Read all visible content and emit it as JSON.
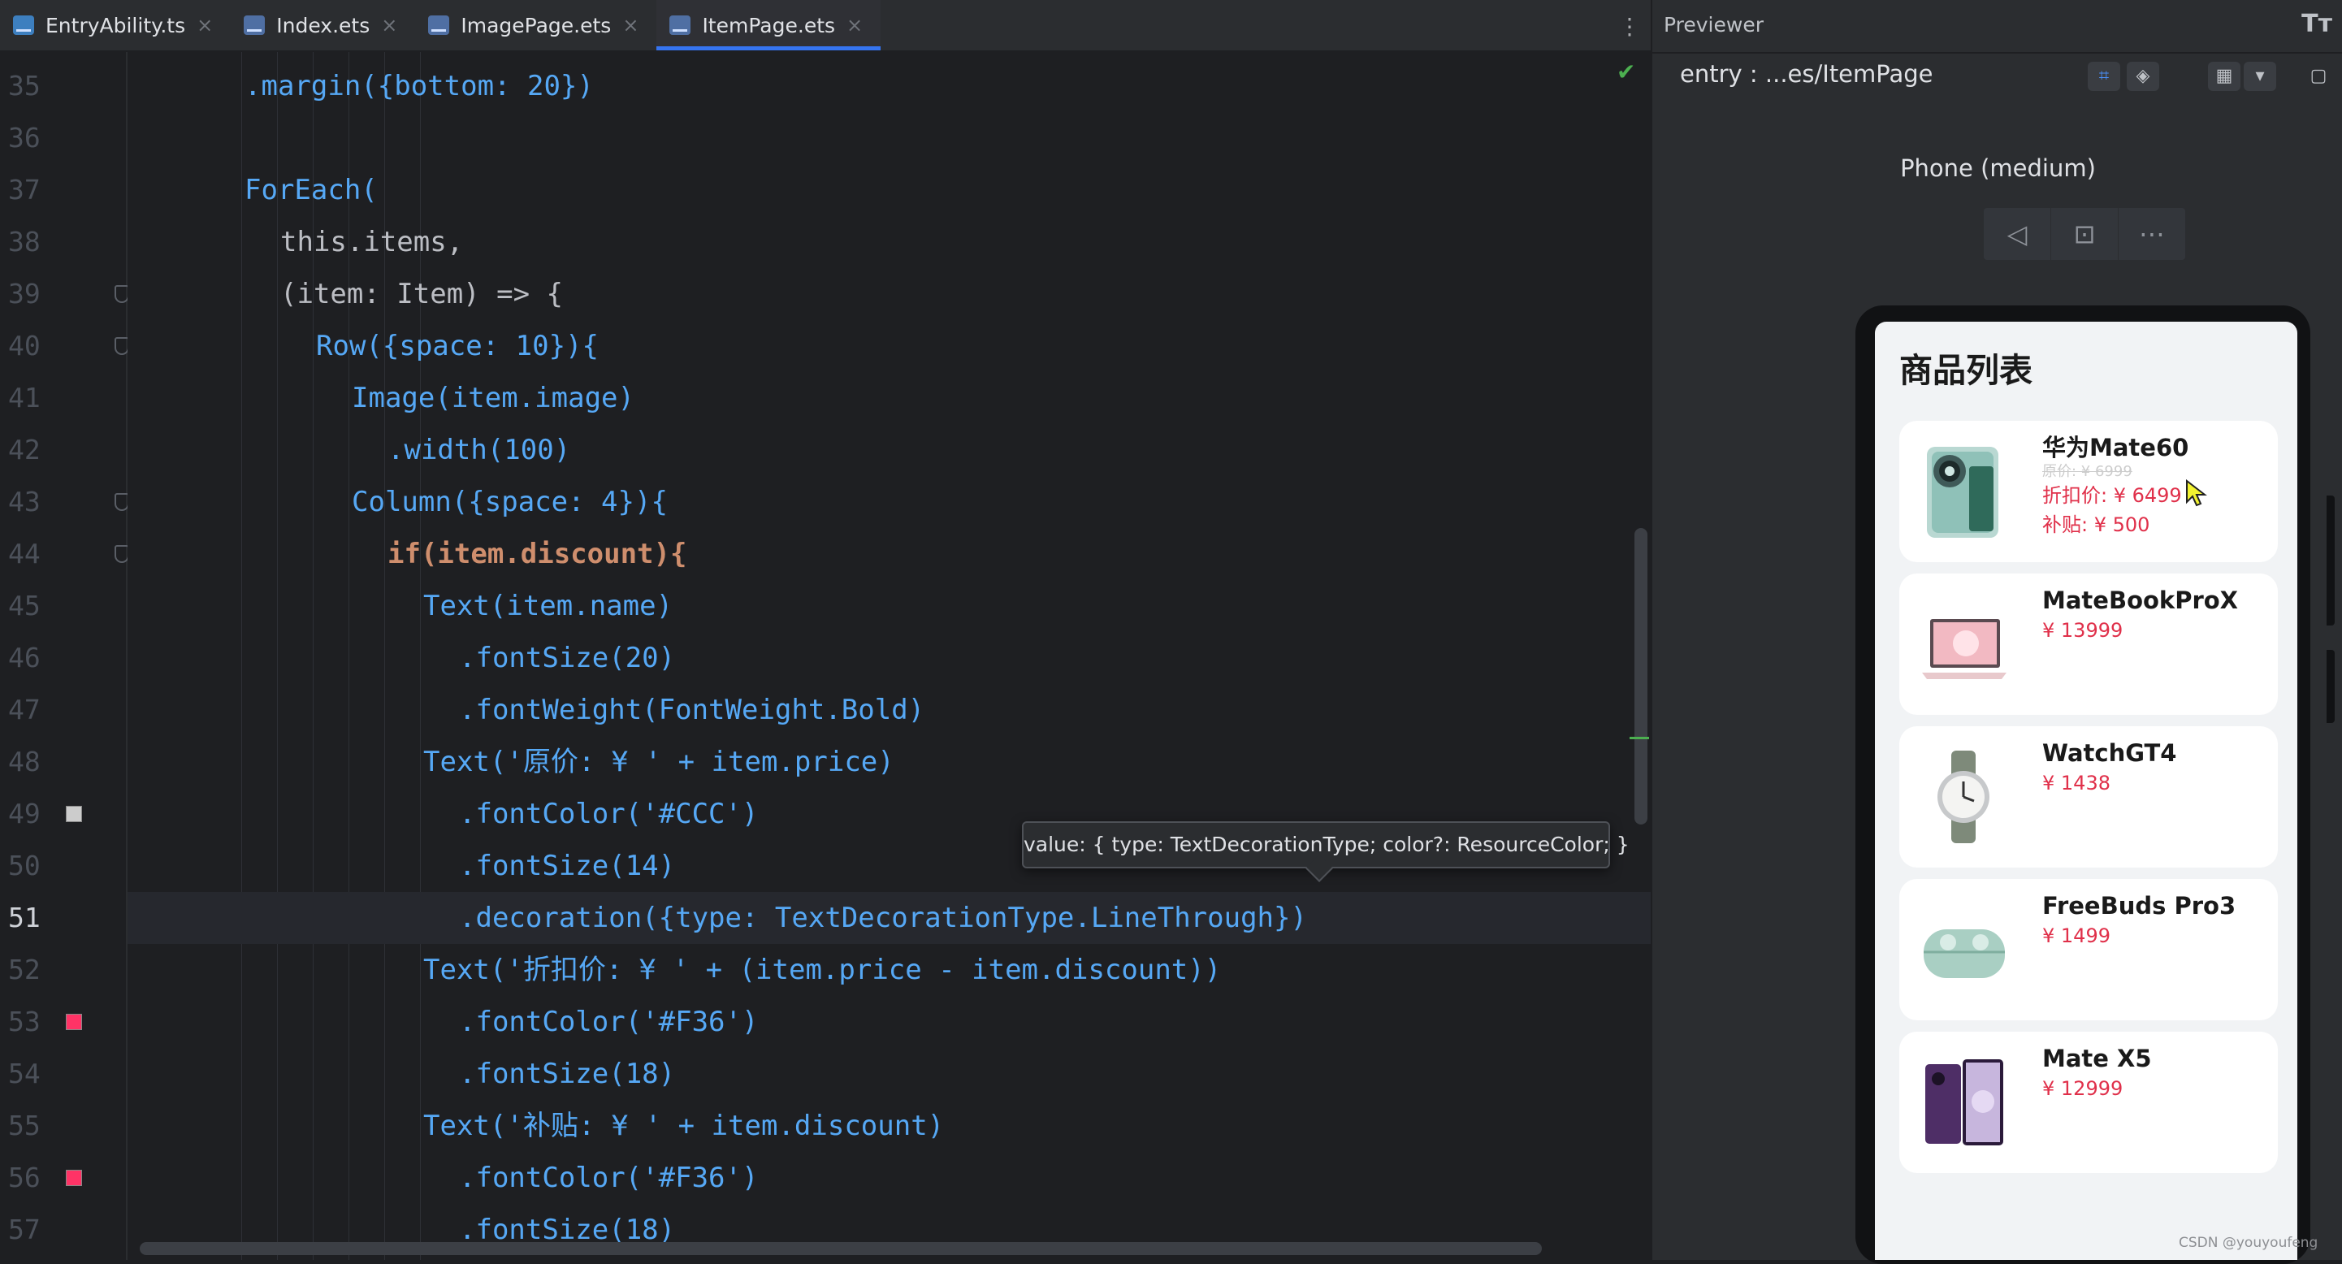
{
  "editor": {
    "tabs": [
      {
        "label": "EntryAbility.ts",
        "kind": "ts"
      },
      {
        "label": "Index.ets",
        "kind": "ets"
      },
      {
        "label": "ImagePage.ets",
        "kind": "ets"
      },
      {
        "label": "ItemPage.ets",
        "kind": "ets",
        "active": true
      }
    ],
    "line_numbers": [
      "35",
      "36",
      "37",
      "38",
      "39",
      "40",
      "41",
      "42",
      "43",
      "44",
      "45",
      "46",
      "47",
      "48",
      "49",
      "50",
      "51",
      "52",
      "53",
      "54",
      "55",
      "56",
      "57"
    ],
    "current_line": "51",
    "tooltip": "value: { type: TextDecorationType; color?: ResourceColor; }",
    "code": {
      "l35": ".margin({bottom: 20})",
      "l37": "ForEach(",
      "l38": "this.items,",
      "l39": "(item: Item) => {",
      "l40": "Row({space: 10}){",
      "l41": "Image(item.image)",
      "l42": ".width(100)",
      "l43": "Column({space: 4}){",
      "l44": "if(item.discount){",
      "l45": "Text(item.name)",
      "l46": ".fontSize(20)",
      "l47": ".fontWeight(FontWeight.Bold)",
      "l48": "Text('原价: ¥ ' + item.price)",
      "l49": ".fontColor('#CCC')",
      "l50": ".fontSize(14)",
      "l51": ".decoration({type: TextDecorationType.LineThrough})",
      "l52": "Text('折扣价: ¥ ' + (item.price - item.discount))",
      "l53": ".fontColor('#F36')",
      "l54": ".fontSize(18)",
      "l55": "Text('补贴: ¥ ' + item.discount)",
      "l56": ".fontColor('#F36')",
      "l57": ".fontSize(18)"
    },
    "swatch_colors": {
      "l49": "#CCCCCC",
      "l53": "#FF3366",
      "l56": "#FF3366"
    }
  },
  "previewer": {
    "title": "Previewer",
    "path": "entry : ...es/ItemPage",
    "device": "Phone (medium)",
    "icons": [
      "inspect-icon",
      "layers-icon",
      "grid-icon",
      "chevron-down-icon",
      "frame-icon",
      "back-icon",
      "rotate-icon",
      "more-icon"
    ],
    "app": {
      "title": "商品列表",
      "items": [
        {
          "name": "华为Mate60",
          "original": "原价: ¥ 6999",
          "discounted": "折扣价: ¥ 6499",
          "subsidy": "补贴: ¥ 500"
        },
        {
          "name": "MateBookProX",
          "price": "¥ 13999"
        },
        {
          "name": "WatchGT4",
          "price": "¥ 1438"
        },
        {
          "name": "FreeBuds Pro3",
          "price": "¥ 1499"
        },
        {
          "name": "Mate X5",
          "price": "¥ 12999"
        }
      ]
    }
  },
  "watermark": "CSDN @youyoufeng"
}
